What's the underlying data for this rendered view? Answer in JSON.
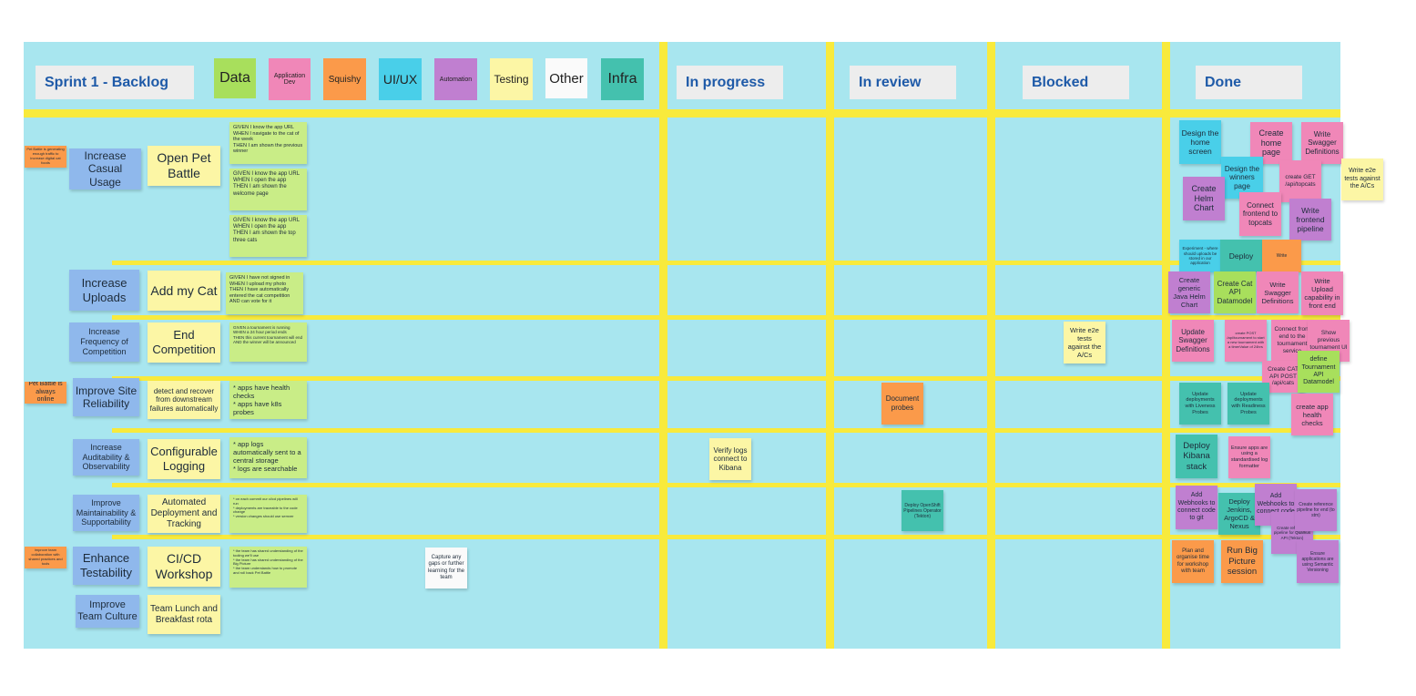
{
  "columns": {
    "backlog": "Sprint 1 - Backlog",
    "in_progress": "In progress",
    "in_review": "In review",
    "blocked": "Blocked",
    "done": "Done"
  },
  "legend": {
    "data": "Data",
    "app_dev": "Application\nDev",
    "squishy": "Squishy",
    "uiux": "UI/UX",
    "automation": "Automation",
    "testing": "Testing",
    "other": "Other",
    "infra": "Infra"
  },
  "outcomes": {
    "casual": "Increase Casual Usage",
    "uploads": "Increase Uploads",
    "competition": "Increase Frequency of Competition",
    "reliability": "Improve Site Reliability",
    "auditability": "Increase Auditability & Observability",
    "maintainability": "Improve Maintainability & Supportability",
    "testability": "Enhance Testability",
    "culture": "Improve Team Culture"
  },
  "features": {
    "open": "Open Pet Battle",
    "addcat": "Add my Cat",
    "endcomp": "End Competition",
    "detect": "detect and recover from downstream failures automatically",
    "logging": "Configurable Logging",
    "deploy": "Automated Deployment and Tracking",
    "cicd": "CI/CD Workshop",
    "lunch": "Team Lunch and Breakfast rota"
  },
  "side_notes": {
    "s1": "Pet Battle is generating enough traffic to increase digital cat foods",
    "s2": "Pet Battle is always online",
    "s3": "improve team collaboration with shared practices and tools"
  },
  "criteria": {
    "c1": "GIVEN I know the app URL\nWHEN I navigate to the cat of the week\nTHEN I am shown the previous winner",
    "c2": "GIVEN I know the app URL\nWHEN I open the app\nTHEN I am shown the welcome page",
    "c3": "GIVEN I know the app URL\nWHEN I open the app\nTHEN I am shown the top three cats",
    "c4": "GIVEN I have not signed in\nWHEN I upload my photo\nTHEN I have automatically entered the cat competition\nAND can vote for it",
    "c5": "GIVEN a tournament is running\nWHEN a 24 hour period ends\nTHEN this current tournament will end\nAND the winner will be announced",
    "c6": "* apps have health checks\n* apps have k8s probes",
    "c7": "* app logs automatically sent to a central storage\n* logs are searchable",
    "c8": "* on each commit our ci/cd pipelines will run\n* deployments are traceable to the code change\n* version changes should use semver",
    "c9": "* the team has shared understanding of the tooling we'll use\n* the team has shared understanding of the Big Picture\n* the team understands how to promote and roll back Pet Battle"
  },
  "cards": {
    "capture": "Capture any gaps or further learning for the team",
    "verify_logs": "Verify logs connect to Kibana",
    "doc_probes": "Document probes",
    "deploy_openshift": "Deploy OpenShift Pipelines Operator (Tekton)",
    "write_e2e_blocked": "Write e2e tests against the A/Cs"
  },
  "done": {
    "d1": "Design the home screen",
    "d2": "Create home page",
    "d3": "Write Swagger Definitions",
    "d4": "Design the winners page",
    "d5": "create GET /api/topcats",
    "d6": "Write e2e tests against the A/Cs",
    "d7": "Create Helm Chart",
    "d8": "Connect frontend to topcats",
    "d9": "Write frontend pipeline",
    "d10": "Experiment - where should uploads be stored in our application",
    "d11": "Deploy",
    "d12": "Write",
    "d13": "Create generic Java Helm Chart",
    "d14": "Create Cat API Datamodel",
    "d15": "Write Swagger Definitions",
    "d16": "Write Upload capability in front end",
    "d17": "Update Swagger Definitions",
    "d18": "create POST /api/tournament to start a new tournament with a timerValue of 24hrs",
    "d19": "Connect front end to the tournament service",
    "d20": "Show previous tournament UI",
    "d21": "Create CAT API POST /api/cats",
    "d22": "define Tournament API Datamodel",
    "d23": "Update deployments with Liveness Probes",
    "d24": "Update deployments with Readiness Probes",
    "d25": "create app health checks",
    "d26": "Deploy Kibana stack",
    "d27": "Ensure apps are using a standardised log formatter",
    "d28": "Add Webhooks to connect code to git",
    "d29": "Deploy Jenkins, ArgoCD & Nexus",
    "d30": "Add Webhooks to connect code",
    "d31": "Create reference pipeline for Quarkus API (Tekton)",
    "d32": "Create reference pipeline for end (to stm)",
    "d33": "Plan and organise time for workshop with team",
    "d34": "Run Big Picture session",
    "d35": "Ensure applications are using Semantic Versioning"
  },
  "colors": {
    "board": "#a8e6ef",
    "lines": "#f8ea3c",
    "header_text": "#1e5aa8"
  }
}
